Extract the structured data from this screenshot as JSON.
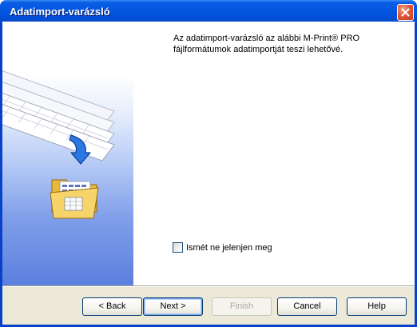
{
  "window": {
    "title": "Adatimport-varázsló"
  },
  "content": {
    "intro_text": "Az adatimport-varázsló az alábbi M-Print® PRO fájlformátumok adatimportját teszi lehetővé.",
    "checkbox_label": "Ismét ne jelenjen meg",
    "checkbox_checked": false
  },
  "buttons": {
    "back": "< Back",
    "next": "Next >",
    "finish": "Finish",
    "cancel": "Cancel",
    "help": "Help"
  },
  "colors": {
    "title_bar": "#0356e0",
    "close_button": "#e0593a",
    "side_panel_bottom": "#5b7fde"
  }
}
